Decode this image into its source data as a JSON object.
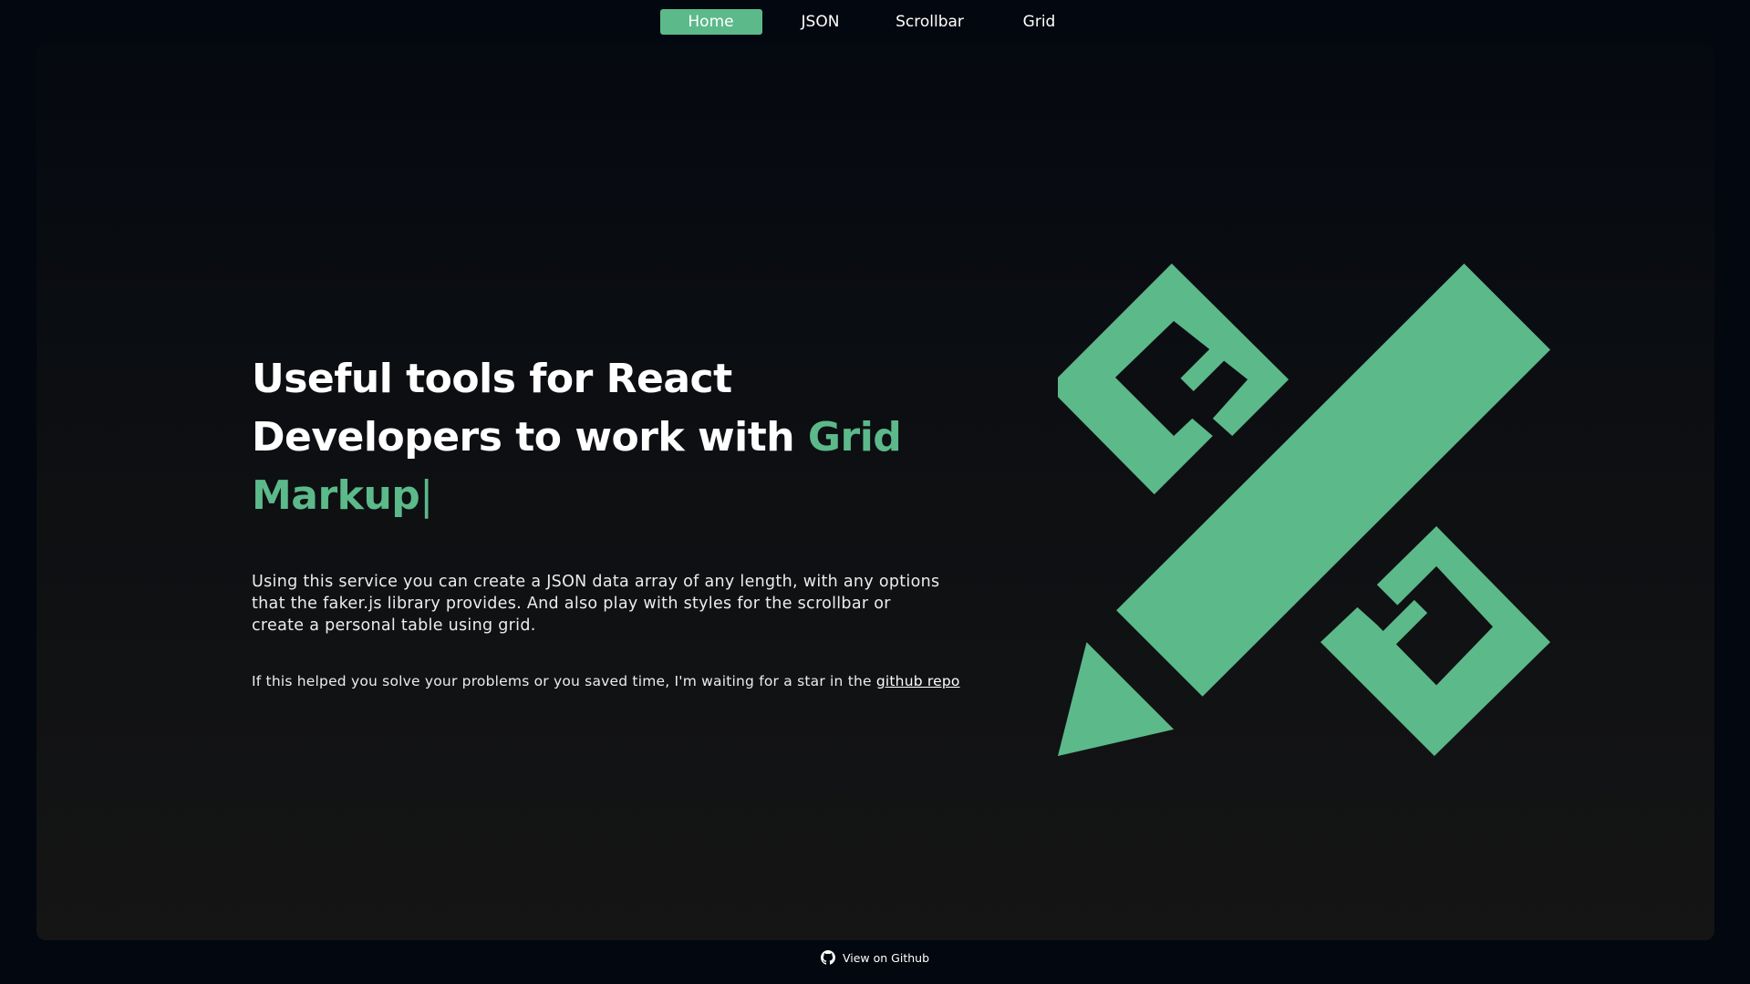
{
  "nav": {
    "items": [
      {
        "label": "Home",
        "active": true
      },
      {
        "label": "JSON",
        "active": false
      },
      {
        "label": "Scrollbar",
        "active": false
      },
      {
        "label": "Grid",
        "active": false
      }
    ]
  },
  "hero": {
    "headline_prefix": "Useful tools for React Developers to work with ",
    "headline_accent": "Grid Markup",
    "cursor": "|",
    "description": "Using this service you can create a JSON data array of any length, with any options that the faker.js library provides. And also play with styles for the scrollbar or create a personal table using grid.",
    "star_text": "If this helped you solve your problems or you saved time, I'm waiting for a star in the ",
    "star_link": "github repo",
    "logo_icon": "pencil-ruler-logo-icon"
  },
  "footer": {
    "github_label": "View on Github",
    "github_icon": "github-icon"
  },
  "colors": {
    "accent": "#5cb98a",
    "background": "#03070f",
    "text": "#ffffff"
  }
}
